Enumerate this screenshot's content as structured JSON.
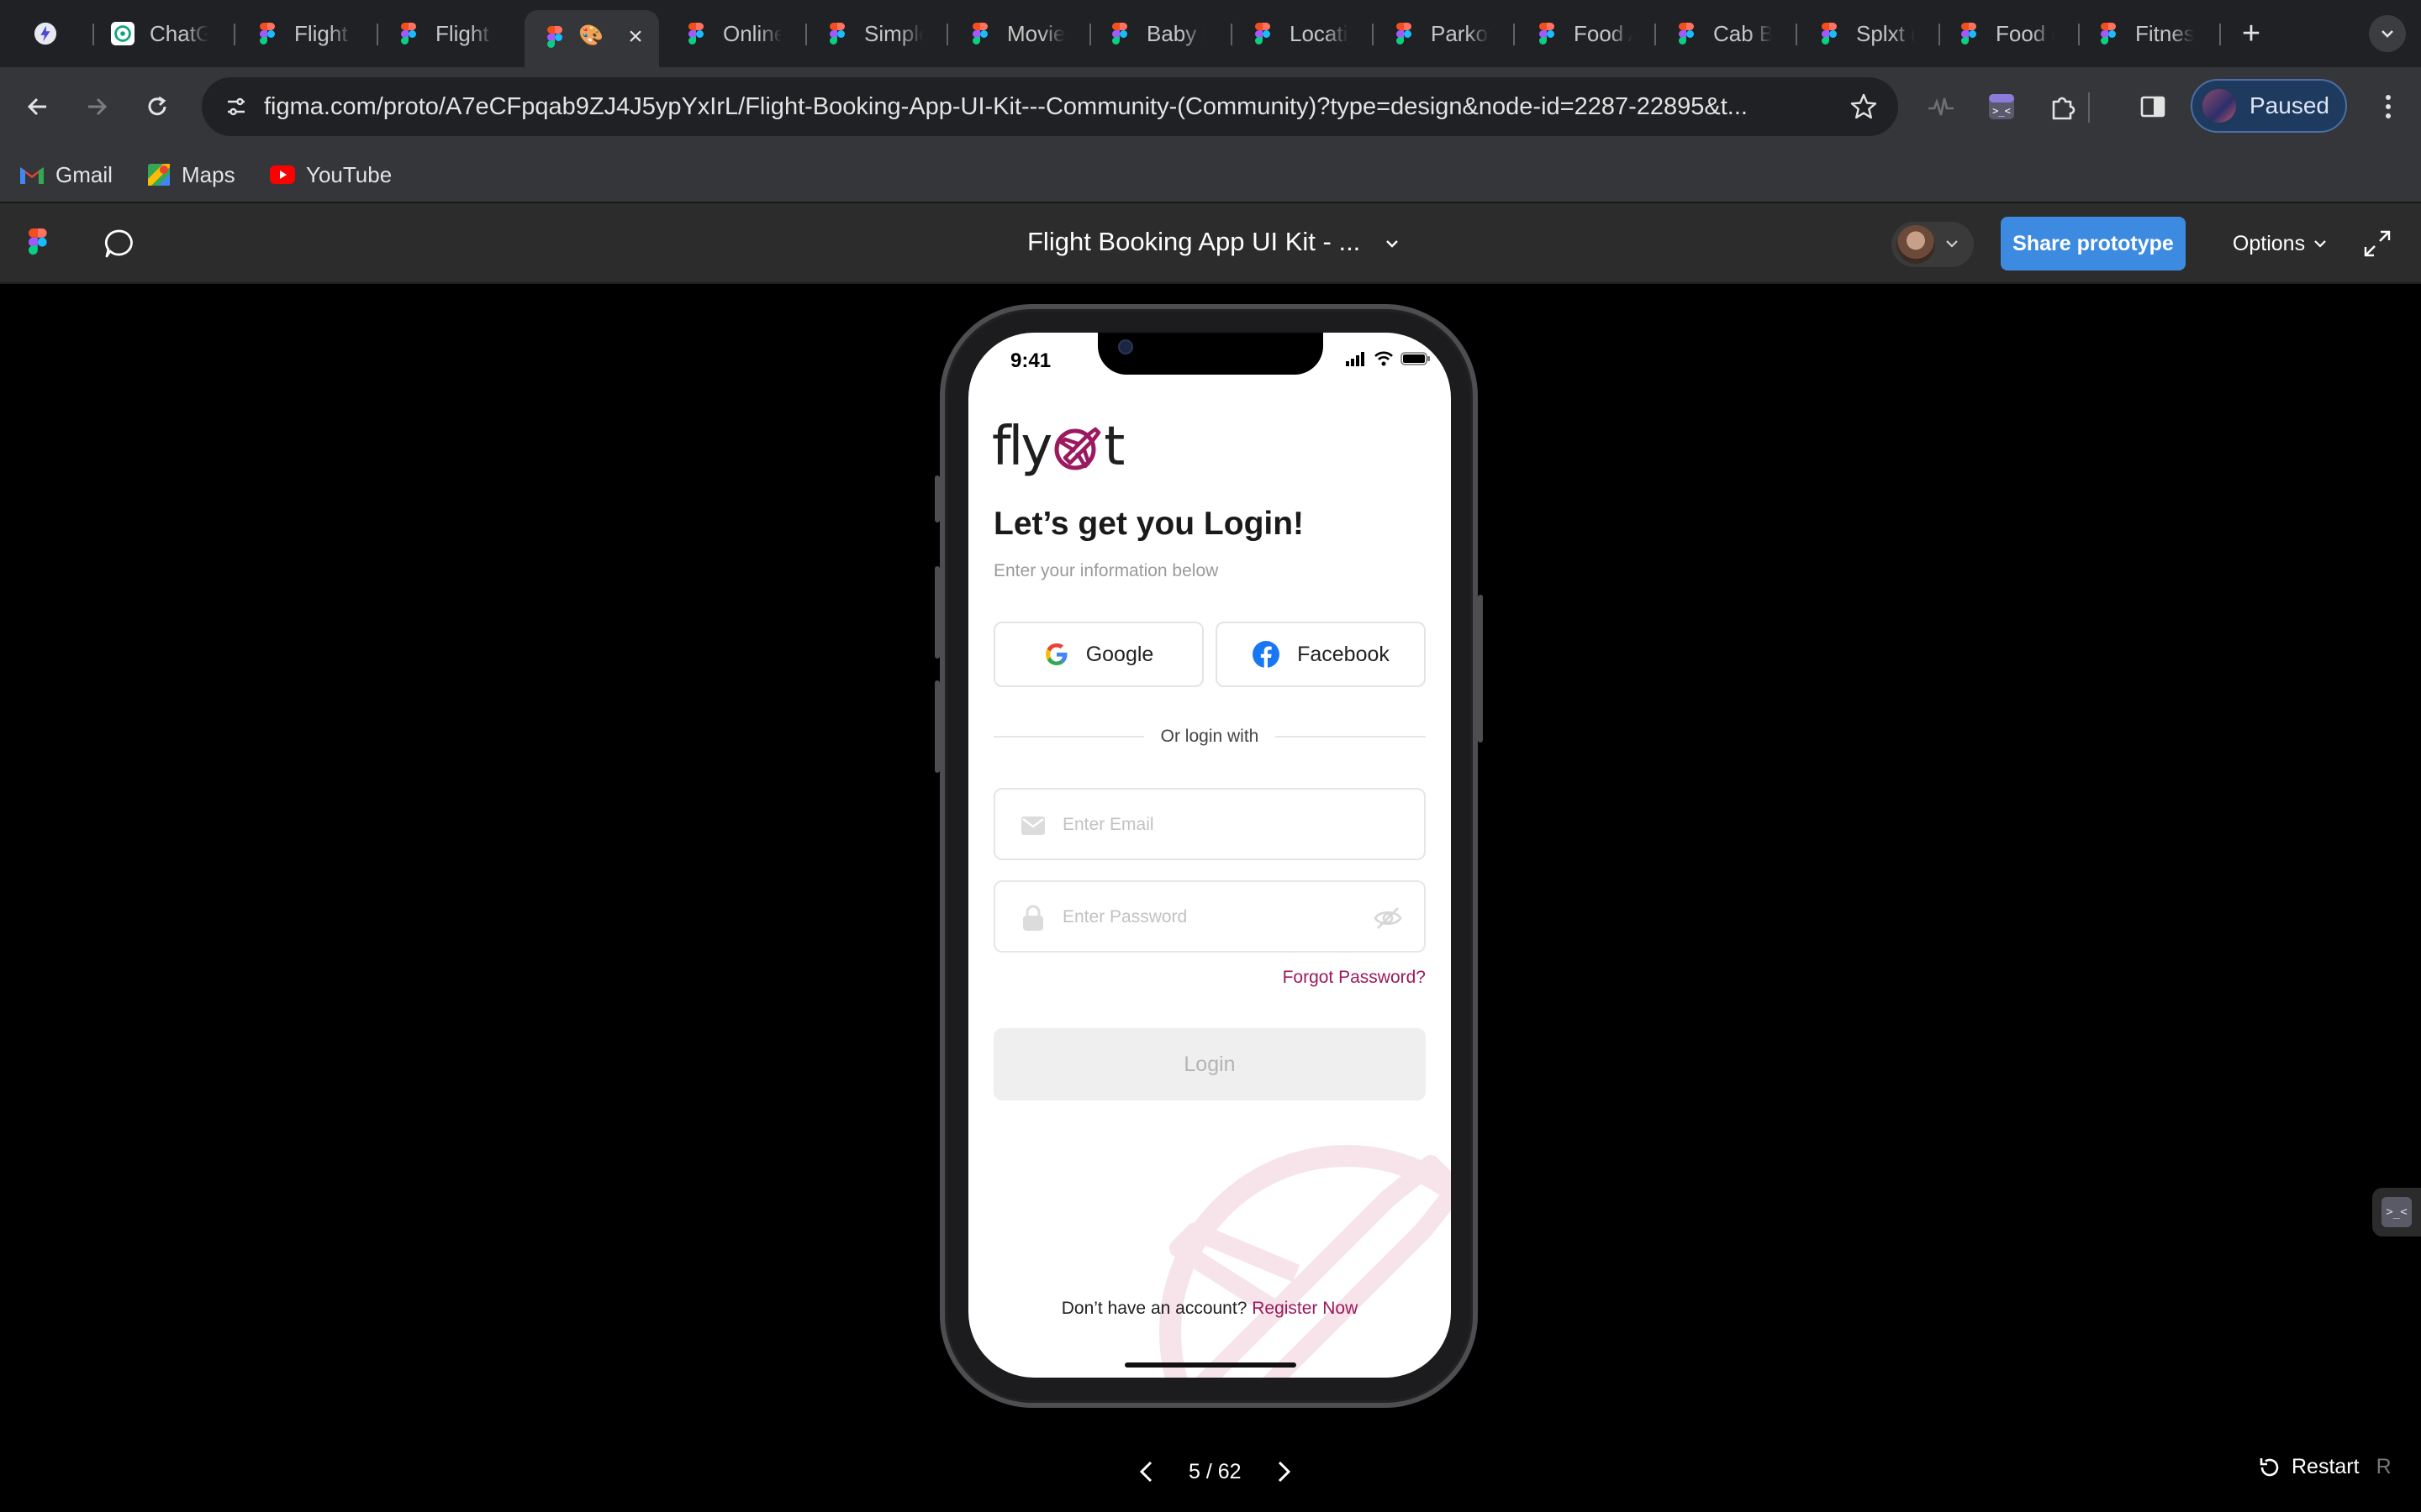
{
  "browser": {
    "tabs": [
      {
        "label": "",
        "icon": "lightning-app-icon"
      },
      {
        "label": "ChatGPT",
        "icon": "chatgpt-icon"
      },
      {
        "label": "Flight Booking",
        "icon": "figma-icon"
      },
      {
        "label": "Flight Booking",
        "icon": "figma-icon"
      },
      {
        "label": "",
        "icon": "figma-icon",
        "active": true,
        "emoji": "🎨"
      },
      {
        "label": "Online",
        "icon": "figma-icon"
      },
      {
        "label": "Simple",
        "icon": "figma-icon"
      },
      {
        "label": "Movie",
        "icon": "figma-icon"
      },
      {
        "label": "Baby E",
        "icon": "figma-icon"
      },
      {
        "label": "Locatio",
        "icon": "figma-icon"
      },
      {
        "label": "Parkov",
        "icon": "figma-icon"
      },
      {
        "label": "Food A",
        "icon": "figma-icon"
      },
      {
        "label": "Cab Bo",
        "icon": "figma-icon"
      },
      {
        "label": "Splxt (",
        "icon": "figma-icon"
      },
      {
        "label": "Food o",
        "icon": "figma-icon"
      },
      {
        "label": "Fitness",
        "icon": "figma-icon"
      }
    ],
    "url": "figma.com/proto/A7eCFpqab9ZJ4J5ypYxIrL/Flight-Booking-App-UI-Kit---Community-(Community)?type=design&node-id=2287-22895&t...",
    "profile_label": "Paused",
    "bookmarks": [
      {
        "label": "Gmail",
        "icon": "gmail-icon"
      },
      {
        "label": "Maps",
        "icon": "maps-icon"
      },
      {
        "label": "YouTube",
        "icon": "youtube-icon"
      }
    ]
  },
  "figma": {
    "file_title": "Flight Booking App UI Kit - ...",
    "share_label": "Share prototype",
    "options_label": "Options",
    "pager": {
      "current": 5,
      "total": 62,
      "text": "5 / 62"
    },
    "restart_label": "Restart",
    "restart_key": "R"
  },
  "app": {
    "status_time": "9:41",
    "logo_text_left": "fly",
    "logo_text_right": "t",
    "heading": "Let’s get you Login!",
    "subheading": "Enter your information below",
    "google_label": "Google",
    "facebook_label": "Facebook",
    "divider_text": "Or login with",
    "email_placeholder": "Enter Email",
    "email_value": "",
    "password_placeholder": "Enter Password",
    "password_value": "",
    "forgot_label": "Forgot Password?",
    "login_label": "Login",
    "no_account_text": "Don’t have an account?",
    "register_label": "Register Now"
  },
  "colors": {
    "brand": "#9b1a5f",
    "share_blue": "#3d8be0",
    "browser_bg": "#202124",
    "toolbar_bg": "#35363a",
    "figma_header": "#2c2c2c"
  }
}
